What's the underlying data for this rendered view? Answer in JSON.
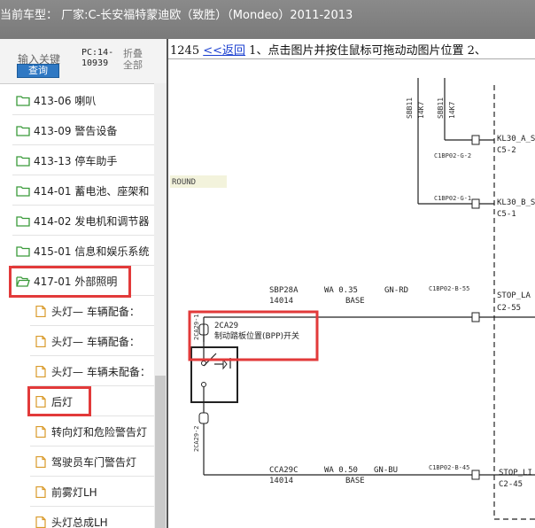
{
  "header": {
    "title": "当前车型： 厂家:C-长安福特蒙迪欧（致胜）（Mondeo）2011-2013"
  },
  "left": {
    "search_label": "输入关键",
    "query_button": "查询",
    "pc_line1": "PC:14-",
    "pc_line2": "10939",
    "fold_line1": "折叠",
    "fold_line2": "全部",
    "tree": [
      {
        "label": "413-06 喇叭",
        "type": "folder"
      },
      {
        "label": "413-09 警告设备",
        "type": "folder"
      },
      {
        "label": "413-13 停车助手",
        "type": "folder"
      },
      {
        "label": "414-01 蓄电池、座架和",
        "type": "folder"
      },
      {
        "label": "414-02 发电机和调节器",
        "type": "folder"
      },
      {
        "label": "415-01 信息和娱乐系统",
        "type": "folder"
      },
      {
        "label": "417-01 外部照明",
        "type": "folder-open"
      },
      {
        "label": "头灯— 车辆配备：",
        "type": "doc"
      },
      {
        "label": "头灯— 车辆配备：",
        "type": "doc"
      },
      {
        "label": "头灯— 车辆未配备：",
        "type": "doc"
      },
      {
        "label": "后灯",
        "type": "doc"
      },
      {
        "label": "转向灯和危险警告灯",
        "type": "doc"
      },
      {
        "label": "驾驶员车门警告灯",
        "type": "doc"
      },
      {
        "label": "前雾灯LH",
        "type": "doc"
      },
      {
        "label": "头灯总成LH",
        "type": "doc"
      }
    ]
  },
  "right": {
    "page_num": "1245",
    "back_link": "<<返回",
    "instruction": "1、点击图片并按住鼠标可拖动动图片位置 2、"
  },
  "diagram": {
    "ground_label": "ROUND",
    "vlabel_1": "SBB11",
    "vlabel_2": "14K7",
    "vlabel_3": "SBB11",
    "vlabel_4": "14K7",
    "conn_c1bp02_g2": "C1BP02-G-2",
    "conn_c1bp02_g1": "C1BP02-G-1",
    "kl30a": "KL30_A_S",
    "c5_2": "C5-2",
    "kl30b": "KL30_B_S",
    "c5_1": "C5-1",
    "wire1_circuit": "SBP28A",
    "wire1_num": "14014",
    "wire1_size": "WA  0.35",
    "wire1_base": "BASE",
    "wire1_color": "GN-RD",
    "conn_b55": "C1BP02-B-55",
    "stop_lamp_1": "STOP_LA",
    "c2_55": "C2-55",
    "switch_id": "2CA29",
    "switch_desc": "制动踏板位置(BPP)开关",
    "switch_pin_top": "2CA29-1",
    "switch_pin_bot": "2CA29-2",
    "wire2_circuit": "CCA29C",
    "wire2_num": "14014",
    "wire2_size": "WA  0.50",
    "wire2_base": "BASE",
    "wire2_color": "GN-BU",
    "conn_b45": "C1BP02-B-45",
    "stop_lamp_2": "STOP_LI",
    "c2_45": "C2-45"
  }
}
